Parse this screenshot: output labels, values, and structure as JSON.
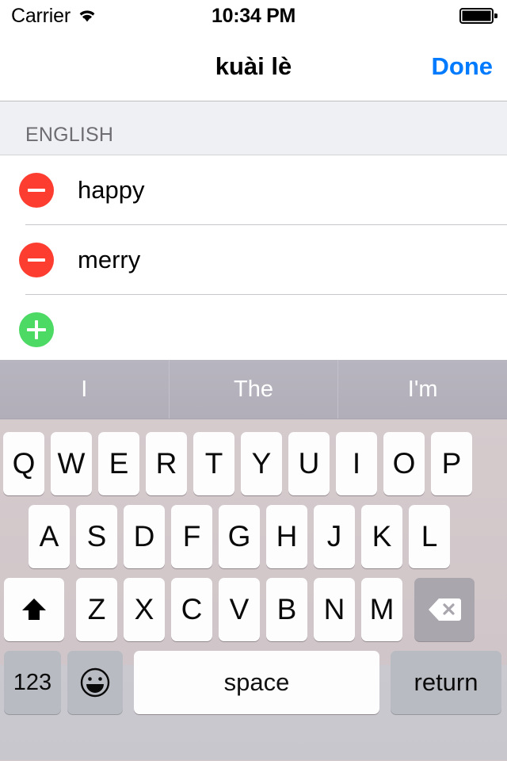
{
  "status_bar": {
    "carrier": "Carrier",
    "wifi_icon": "wifi-icon",
    "time": "10:34 PM",
    "battery_icon": "battery-full-icon"
  },
  "nav_bar": {
    "title": "kuài lè",
    "done_label": "Done",
    "done_color": "#007AFF"
  },
  "table": {
    "section_header": "ENGLISH",
    "rows": [
      {
        "label": "happy",
        "edit_icon": "minus-circle-icon",
        "edit_color": "#FC3D2F"
      },
      {
        "label": "merry",
        "edit_icon": "minus-circle-icon",
        "edit_color": "#FC3D2F"
      }
    ],
    "add_row": {
      "label": "",
      "edit_icon": "plus-circle-icon",
      "edit_color": "#4CD964"
    }
  },
  "keyboard": {
    "predictions": [
      "I",
      "The",
      "I'm"
    ],
    "row1": [
      "Q",
      "W",
      "E",
      "R",
      "T",
      "Y",
      "U",
      "I",
      "O",
      "P"
    ],
    "row2": [
      "A",
      "S",
      "D",
      "F",
      "G",
      "H",
      "J",
      "K",
      "L"
    ],
    "row3": [
      "Z",
      "X",
      "C",
      "V",
      "B",
      "N",
      "M"
    ],
    "shift_icon": "shift-arrow-icon",
    "backspace_icon": "backspace-delete-icon",
    "numbers_label": "123",
    "emoji_icon": "emoji-smiley-icon",
    "space_label": "space",
    "return_label": "return"
  }
}
